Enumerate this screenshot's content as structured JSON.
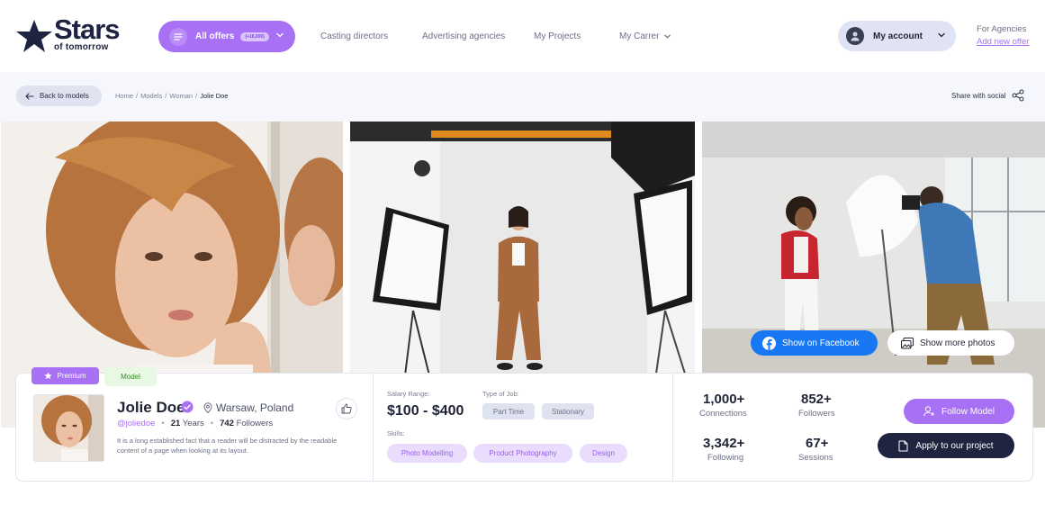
{
  "header": {
    "logo_brand": "Stars",
    "logo_tagline": "of tomorrow",
    "offers_label": "All offers",
    "offers_count": "(+16,000)",
    "nav": [
      "Casting directors",
      "Advertising agencies",
      "My Projects",
      "My Carrer"
    ],
    "account_label": "My account",
    "agencies_label": "For Agencies",
    "add_offer_label": "Add new offer"
  },
  "breadcrumb_bar": {
    "back_label": "Back to models",
    "crumbs": [
      "Home",
      "Models",
      "Woman"
    ],
    "current": "Jolie Doe",
    "share_label": "Share with social"
  },
  "gallery": {
    "facebook_label": "Show on Facebook",
    "more_photos_label": "Show more photos"
  },
  "profile": {
    "badge_premium": "Premium",
    "badge_model": "Model",
    "name": "Jolie Doe",
    "location": "Warsaw, Poland",
    "handle": "@joliedoe",
    "age_value": "21",
    "age_unit": "Years",
    "followers_value": "742",
    "followers_unit": "Followers",
    "description": "It is a long established fact that a reader will be distracted by the readable content of a page when looking at its layout."
  },
  "job": {
    "salary_label": "Salary Range:",
    "salary": "$100 - $400",
    "type_label": "Type of Job:",
    "types": [
      "Part Time",
      "Stationary"
    ],
    "skills_label": "Skills:",
    "skills": [
      "Photo Modelling",
      "Product Photography",
      "Design"
    ]
  },
  "stats": [
    {
      "value": "1,000+",
      "label": "Connections"
    },
    {
      "value": "852+",
      "label": "Followers"
    },
    {
      "value": "3,342+",
      "label": "Following"
    },
    {
      "value": "67+",
      "label": "Sessions"
    }
  ],
  "actions": {
    "follow_label": "Follow Model",
    "apply_label": "Apply to our project"
  },
  "colors": {
    "accent": "#a770f5",
    "dark": "#1f2440",
    "facebook": "#1877f2"
  }
}
